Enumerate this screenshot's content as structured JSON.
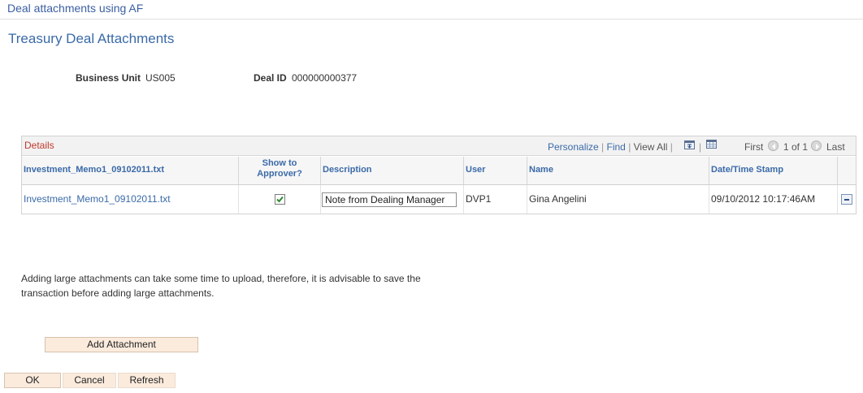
{
  "window": {
    "title": "Deal attachments using AF"
  },
  "page": {
    "title": "Treasury Deal Attachments"
  },
  "fields": {
    "business_unit_label": "Business Unit",
    "business_unit_value": "US005",
    "deal_id_label": "Deal ID",
    "deal_id_value": "000000000377"
  },
  "grid": {
    "caption": "Details",
    "nav": {
      "personalize": "Personalize",
      "find": "Find",
      "view_all": "View All",
      "first": "First",
      "range": "1 of 1",
      "last": "Last"
    },
    "columns": {
      "file": "Investment_Memo1_09102011.txt",
      "show_to_approver": "Show to Approver?",
      "description": "Description",
      "user": "User",
      "name": "Name",
      "datetime": "Date/Time Stamp"
    },
    "rows": [
      {
        "file": "Investment_Memo1_09102011.txt",
        "show_to_approver": true,
        "description": "Note from Dealing Manager",
        "user": "DVP1",
        "name": "Gina Angelini",
        "datetime": "09/10/2012 10:17:46AM"
      }
    ]
  },
  "note": "Adding large attachments can take some time to upload, therefore, it is advisable to save the transaction before adding large attachments.",
  "buttons": {
    "add_attachment": "Add Attachment",
    "ok": "OK",
    "cancel": "Cancel",
    "refresh": "Refresh"
  },
  "icons": {
    "download": "download-icon",
    "spreadsheet": "spreadsheet-icon",
    "prev": "arrow-left-icon",
    "next": "arrow-right-icon",
    "delete_row": "delete-row-icon",
    "check": "checkmark-icon"
  },
  "colors": {
    "link": "#3a6aa8",
    "caption": "#c0392b",
    "button_bg": "#fbebdd",
    "check": "#2e8b2e"
  }
}
